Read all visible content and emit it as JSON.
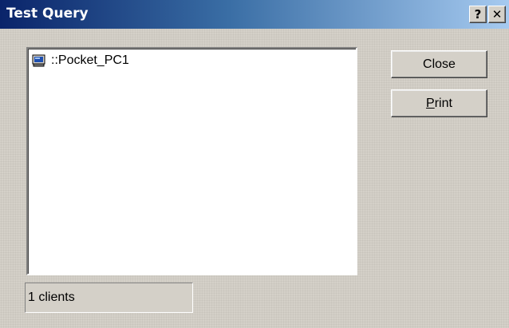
{
  "window": {
    "title": "Test Query",
    "help_glyph": "?",
    "close_glyph": "✕"
  },
  "clients": {
    "items": [
      {
        "icon": "pocket-pc-device-icon",
        "label": "::Pocket_PC1"
      }
    ],
    "status_text": "1 clients"
  },
  "buttons": {
    "close_label": "Close",
    "print_mnemonic": "P",
    "print_rest": "rint"
  },
  "colors": {
    "title_start": "#0a246a",
    "title_end": "#a6caf0",
    "face": "#d4d0c8"
  }
}
